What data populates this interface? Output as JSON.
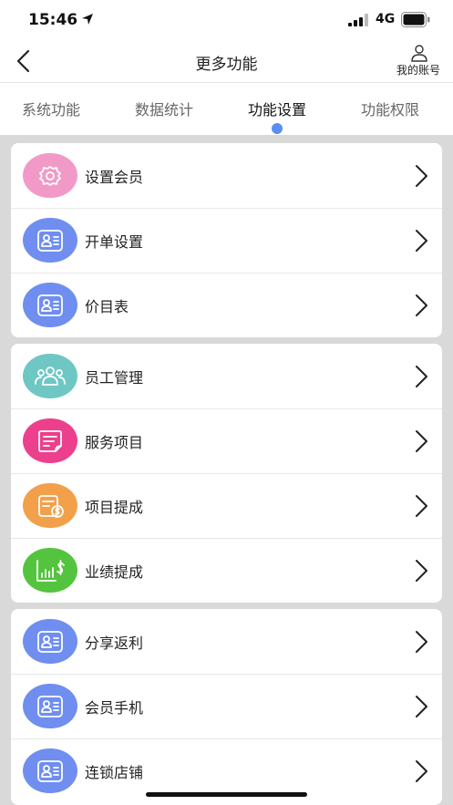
{
  "status_bar": {
    "time": "15:46",
    "network": "4G"
  },
  "nav": {
    "title": "更多功能",
    "account_label": "我的账号"
  },
  "tabs": [
    {
      "label": "系统功能",
      "active": false
    },
    {
      "label": "数据统计",
      "active": false
    },
    {
      "label": "功能设置",
      "active": true
    },
    {
      "label": "功能权限",
      "active": false
    }
  ],
  "groups": [
    {
      "items": [
        {
          "label": "设置会员",
          "icon": "gear-icon",
          "color": "#f29ac7"
        },
        {
          "label": "开单设置",
          "icon": "id-card-icon",
          "color": "#6f8ef0"
        },
        {
          "label": "价目表",
          "icon": "id-card-icon",
          "color": "#6f8ef0"
        }
      ]
    },
    {
      "items": [
        {
          "label": "员工管理",
          "icon": "staff-icon",
          "color": "#6fc7c4"
        },
        {
          "label": "服务项目",
          "icon": "service-icon",
          "color": "#ec3f8c"
        },
        {
          "label": "项目提成",
          "icon": "commission-icon",
          "color": "#f2a04a"
        },
        {
          "label": "业绩提成",
          "icon": "performance-icon",
          "color": "#54c43e"
        }
      ]
    },
    {
      "items": [
        {
          "label": "分享返利",
          "icon": "id-card-icon",
          "color": "#6f8ef0"
        },
        {
          "label": "会员手机",
          "icon": "id-card-icon",
          "color": "#6f8ef0"
        },
        {
          "label": "连锁店铺",
          "icon": "id-card-icon",
          "color": "#6f8ef0"
        }
      ]
    }
  ]
}
